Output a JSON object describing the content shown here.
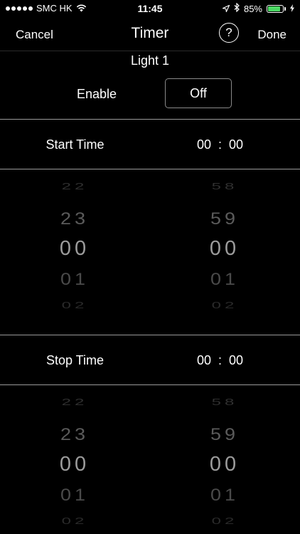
{
  "status_bar": {
    "carrier": "SMC HK",
    "time": "11:45",
    "battery_percent": "85%",
    "battery_level": 0.85,
    "icons": [
      "signal-dots-icon",
      "wifi-icon",
      "location-arrow-icon",
      "bluetooth-icon",
      "battery-icon",
      "charging-bolt-icon"
    ]
  },
  "nav": {
    "cancel_label": "Cancel",
    "title": "Timer",
    "help_symbol": "?",
    "done_label": "Done"
  },
  "device": {
    "name": "Light 1",
    "enable_label": "Enable",
    "enable_value": "Off"
  },
  "start": {
    "label": "Start Time",
    "hour": "00",
    "separator": ":",
    "minute": "00",
    "picker": {
      "hours": [
        "22",
        "23",
        "00",
        "01",
        "02"
      ],
      "minutes": [
        "58",
        "59",
        "00",
        "01",
        "02"
      ]
    }
  },
  "stop": {
    "label": "Stop Time",
    "hour": "00",
    "separator": ":",
    "minute": "00",
    "picker": {
      "hours": [
        "22",
        "23",
        "00",
        "01",
        "02"
      ],
      "minutes": [
        "58",
        "59",
        "00",
        "01",
        "02"
      ]
    }
  },
  "colors": {
    "background": "#000000",
    "text": "#ffffff",
    "battery": "#4cd964",
    "divider": "#9a9a9a"
  }
}
